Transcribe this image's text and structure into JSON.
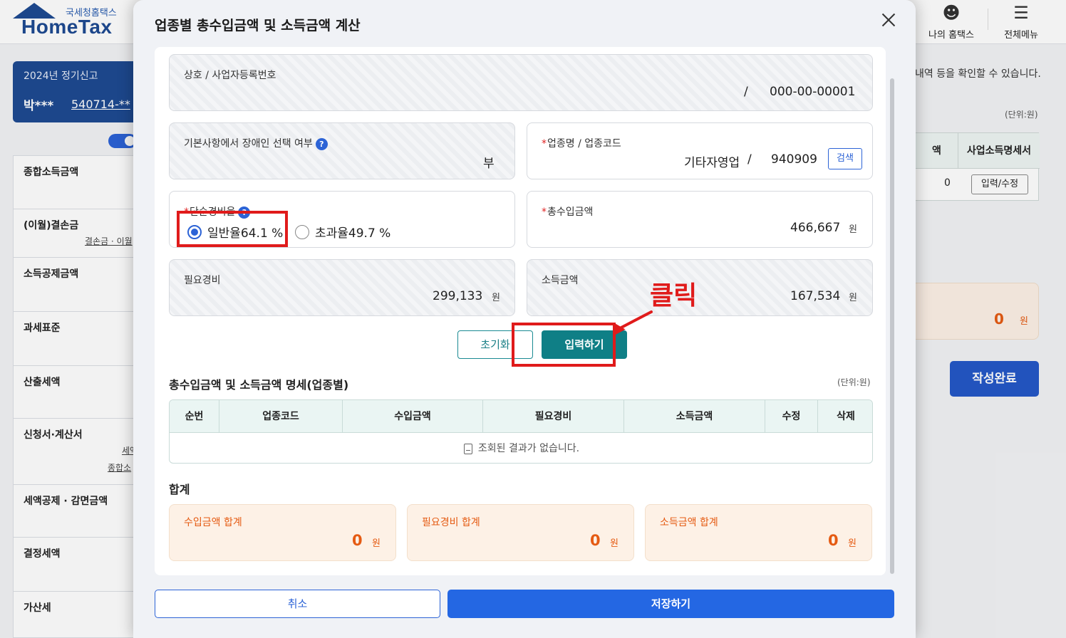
{
  "site": {
    "logo_sub": "국세청홈택스",
    "logo_main": "HomeTax",
    "my_hometax": "나의 홈택스",
    "all_menu": "전체메뉴"
  },
  "sidebar": {
    "year_label": "2024년 정기신고",
    "user_name": "박***",
    "user_id": "540714-**",
    "items": [
      {
        "label": "종합소득금액",
        "sub": ""
      },
      {
        "label": "(이월)결손금",
        "sub": "결손금 · 이월"
      },
      {
        "label": "소득공제금액",
        "sub": ""
      },
      {
        "label": "과세표준",
        "sub": ""
      },
      {
        "label": "산출세액",
        "sub": ""
      },
      {
        "label": "신청서·계산서",
        "sub": "세액",
        "sub2": "종합소"
      },
      {
        "label": "세액공제 · 감면금액",
        "sub": ""
      },
      {
        "label": "결정세액",
        "sub": ""
      },
      {
        "label": "가산세",
        "sub": ""
      }
    ]
  },
  "background": {
    "note": "내역 등을 확인할 수 있습니다.",
    "unit": "(단위:원)",
    "table_col_partial": "액",
    "table_col": "사업소득명세서",
    "table_zero": "0",
    "table_btn": "입력/수정",
    "sum_value": "0",
    "sum_unit": "원",
    "done_button": "작성완료"
  },
  "modal": {
    "title": "업종별 총수입금액 및 소득금액 계산",
    "business": {
      "label": "상호 / 사업자등록번호",
      "slash": "/",
      "reg_no": "000-00-00001"
    },
    "disabled": {
      "label": "기본사항에서 장애인 선택 여부",
      "value": "부"
    },
    "industry": {
      "label": "업종명 / 업종코드",
      "name": "기타자영업",
      "slash": "/",
      "code": "940909",
      "search_btn": "검색"
    },
    "expense_rate": {
      "label": "단순경비율",
      "options": [
        {
          "label": "일반율64.1 %",
          "selected": true
        },
        {
          "label": "초과율49.7 %",
          "selected": false
        }
      ]
    },
    "gross_income": {
      "label": "총수입금액",
      "value": "466,667",
      "unit": "원"
    },
    "expenses": {
      "label": "필요경비",
      "value": "299,133",
      "unit": "원"
    },
    "income": {
      "label": "소득금액",
      "value": "167,534",
      "unit": "원"
    },
    "reset_btn": "초기화",
    "enter_btn": "입력하기",
    "detail": {
      "title": "총수입금액 및 소득금액 명세(업종별)",
      "unit": "(단위:원)",
      "columns": [
        "순번",
        "업종코드",
        "수입금액",
        "필요경비",
        "소득금액",
        "수정",
        "삭제"
      ],
      "empty": "조회된 결과가 없습니다."
    },
    "totals": {
      "title": "합계",
      "items": [
        {
          "label": "수입금액 합계",
          "value": "0",
          "unit": "원"
        },
        {
          "label": "필요경비 합계",
          "value": "0",
          "unit": "원"
        },
        {
          "label": "소득금액 합계",
          "value": "0",
          "unit": "원"
        }
      ]
    },
    "cancel_btn": "취소",
    "save_btn": "저장하기"
  },
  "annotation": {
    "text": "클릭",
    "color": "#e01b1b"
  },
  "colors": {
    "brand": "#1e4a92",
    "primary": "#2467e3",
    "teal": "#0f7f86",
    "orange": "#e55b13"
  }
}
